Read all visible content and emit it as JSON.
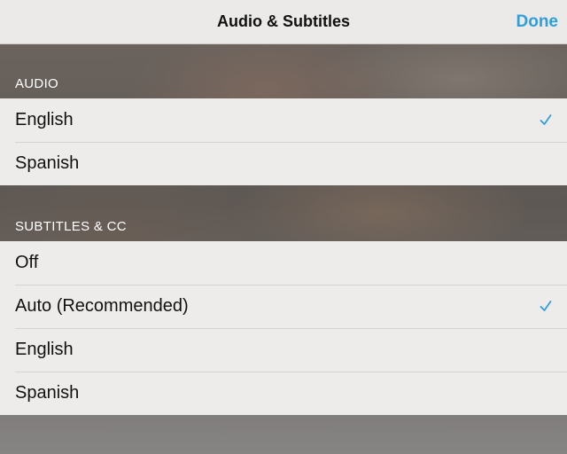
{
  "nav": {
    "title": "Audio & Subtitles",
    "done_label": "Done"
  },
  "audio": {
    "header": "AUDIO",
    "items": [
      {
        "label": "English",
        "selected": true
      },
      {
        "label": "Spanish",
        "selected": false
      }
    ]
  },
  "subtitles": {
    "header": "SUBTITLES & CC",
    "items": [
      {
        "label": "Off",
        "selected": false
      },
      {
        "label": "Auto (Recommended)",
        "selected": true
      },
      {
        "label": "English",
        "selected": false
      },
      {
        "label": "Spanish",
        "selected": false
      }
    ]
  },
  "colors": {
    "accent": "#2f9ed9"
  },
  "icons": {
    "selected": "checkmark-icon"
  }
}
